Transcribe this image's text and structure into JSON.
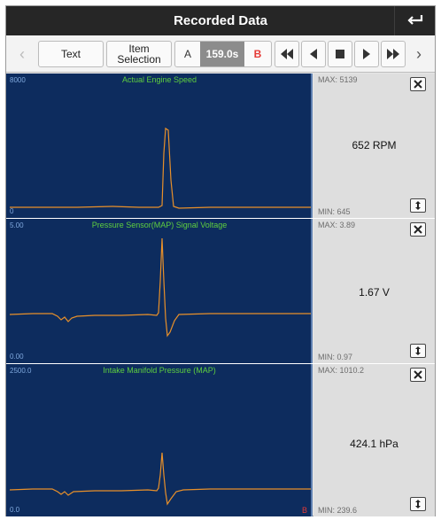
{
  "header": {
    "title": "Recorded Data"
  },
  "toolbar": {
    "text_label": "Text",
    "item_selection_label": "Item\nSelection",
    "marker_a": "A",
    "time": "159.0s",
    "marker_b": "B"
  },
  "panels": [
    {
      "title": "Actual Engine Speed",
      "y_max": "8000",
      "y_min": "0",
      "max_label": "MAX: 5139",
      "min_label": "MIN: 645",
      "value": "652 RPM",
      "b_marker": ""
    },
    {
      "title": "Pressure Sensor(MAP) Signal Voltage",
      "y_max": "5.00",
      "y_min": "0.00",
      "max_label": "MAX: 3.89",
      "min_label": "MIN: 0.97",
      "value": "1.67 V",
      "b_marker": ""
    },
    {
      "title": "Intake Manifold Pressure (MAP)",
      "y_max": "2500.0",
      "y_min": "0.0",
      "max_label": "MAX: 1010.2",
      "min_label": "MIN: 239.6",
      "value": "424.1 hPa",
      "b_marker": "B"
    }
  ],
  "colors": {
    "graph_bg": "#0d2c5e",
    "trace": "#e8902a",
    "title_green": "#5fcf3f",
    "marker_red": "#e53935"
  }
}
